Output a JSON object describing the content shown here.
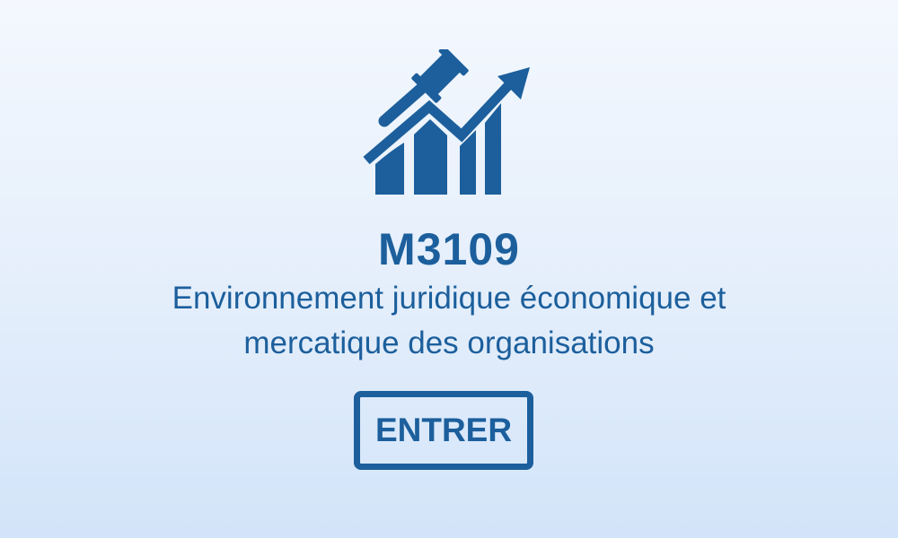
{
  "course": {
    "code": "M3109",
    "title_line1": "Environnement juridique économique et",
    "title_line2": "mercatique des organisations"
  },
  "actions": {
    "enter_label": "ENTRER"
  },
  "icons": {
    "logo": "gavel-rising-chart-icon"
  },
  "colors": {
    "brand": "#1c5f9c",
    "background_top": "#f4f8fe",
    "background_bottom": "#d2e4f9"
  }
}
